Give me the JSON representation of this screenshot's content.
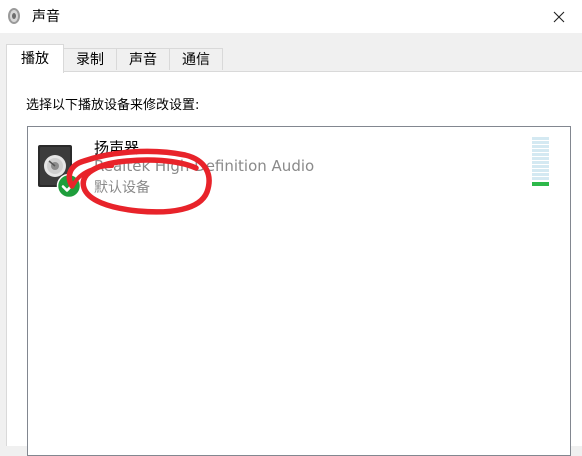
{
  "window": {
    "title": "声音",
    "title_icon": "speaker-icon",
    "close_icon": "close-icon"
  },
  "tabs": [
    {
      "label": "播放",
      "active": true
    },
    {
      "label": "录制",
      "active": false
    },
    {
      "label": "声音",
      "active": false
    },
    {
      "label": "通信",
      "active": false
    }
  ],
  "playback": {
    "instruction": "选择以下播放设备来修改设置:",
    "devices": [
      {
        "name": "扬声器",
        "description": "Realtek High Definition Audio",
        "status": "默认设备",
        "icon": "speaker-device-icon",
        "badge_icon": "default-device-check-icon"
      }
    ]
  },
  "colors": {
    "accent_check": "#1f9e3c",
    "meter_active": "#2db84a",
    "annotation": "#e8232a"
  }
}
